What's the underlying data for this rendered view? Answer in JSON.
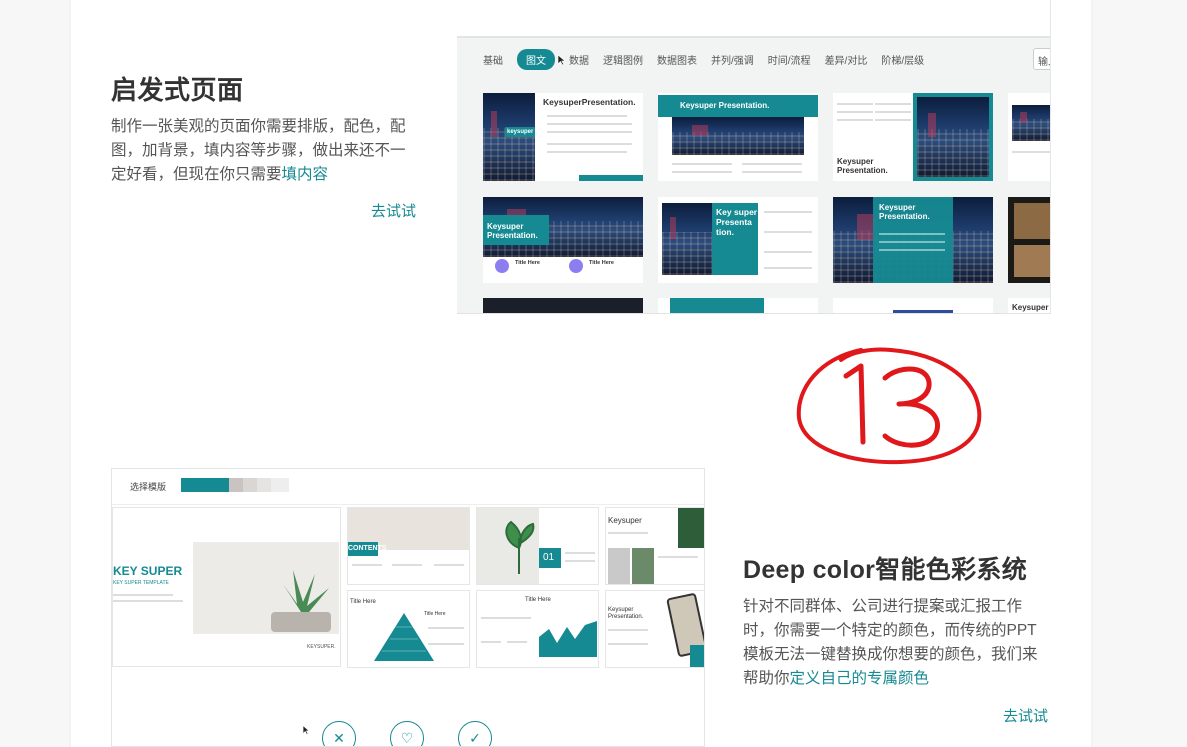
{
  "section1": {
    "title": "启发式页面",
    "desc_line1": "制作一张美观的页面你需要排版，配色，配",
    "desc_line2": "图，加背景，填内容等步骤，做出来还不一",
    "desc_line3_a": "定好看，但现在你只需要",
    "desc_line3_highlight": "填内容",
    "try_label": "去试试"
  },
  "shot1": {
    "tabs": [
      "基础",
      "图文",
      "数据",
      "逻辑图例",
      "数据图表",
      "并列/强调",
      "时间/流程",
      "差异/对比",
      "阶梯/层级"
    ],
    "active_tab": "图文",
    "search_placeholder": "输入",
    "thumbs": {
      "t1_title": "KeysuperPresentation.",
      "t1_badge": "keysuper",
      "t2_title": "Keysuper Presentation.",
      "t3_title": "Keysuper Presentation.",
      "t4_title": "Keysuper Presentation.",
      "t5_title": "Key super Presenta tion.",
      "t6_title": "Keysuper Presentation.",
      "t7_title": "Keysuper",
      "title_here": "Title Here"
    }
  },
  "annotation": {
    "text": "13",
    "color": "#e0171b"
  },
  "section2": {
    "title": "Deep color智能色彩系统",
    "desc_line1": "针对不同群体、公司进行提案或汇报工作",
    "desc_line2": "时，你需要一个特定的颜色，而传统的PPT",
    "desc_line3": "模板无法一键替换成你想要的颜色，我们来",
    "desc_line4_a": "帮助你",
    "desc_line4_highlight": "定义自己的专属颜色",
    "try_label": "去试试"
  },
  "shot2": {
    "select_label": "选择模版",
    "swatches": [
      "#168a92",
      "#c9c4c1",
      "#d9d6d4",
      "#e6e4e3",
      "#efeeee"
    ],
    "big_title": "KEY SUPER",
    "big_sub": "KEY SUPER TEMPLATE",
    "big_brand": "KEYSUPER.",
    "contents_label": "CONTENTS",
    "num_label": "01",
    "keysuper_label": "Keysuper",
    "keysuper_pres": "Keysuper Presentation.",
    "title_here": "Title Here",
    "title_here2": "Title Here"
  },
  "colors": {
    "accent": "#168a92",
    "text": "#333333"
  }
}
